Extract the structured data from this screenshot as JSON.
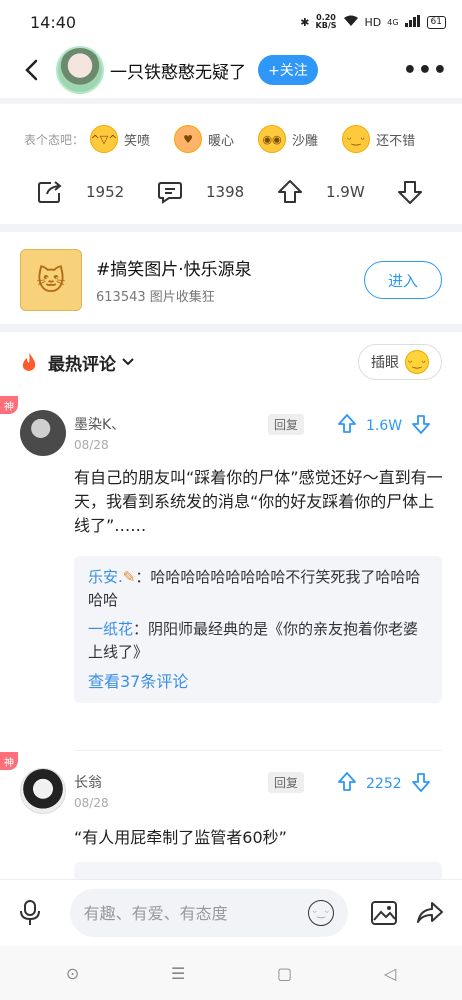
{
  "status": {
    "time": "14:40",
    "speed_value": "0.20",
    "speed_unit": "KB/S",
    "hd": "HD",
    "signal": "4G",
    "battery": "61"
  },
  "nav": {
    "name": "一只铁憨憨无疑了",
    "follow_label": "+关注"
  },
  "reactions": {
    "label": "表个态吧：",
    "items": [
      {
        "label": "笑喷",
        "icon": "laugh-cry-emoji"
      },
      {
        "label": "暖心",
        "icon": "heart-hug-emoji"
      },
      {
        "label": "沙雕",
        "icon": "silly-emoji"
      },
      {
        "label": "还不错",
        "icon": "okay-emoji"
      }
    ]
  },
  "stats": {
    "shares": "1952",
    "comments": "1398",
    "likes": "1.9W"
  },
  "topic": {
    "title": "#搞笑图片·快乐源泉",
    "subtitle": "613543 图片收集狂",
    "enter_label": "进入"
  },
  "hot": {
    "title": "最热评论",
    "insert_label": "插眼"
  },
  "comments": [
    {
      "badge": "神",
      "name": "墨染K、",
      "date": "08/28",
      "reply_label": "回复",
      "likes": "1.6W",
      "body": "有自己的朋友叫“踩着你的尸体”感觉还好～直到有一天，我看到系统发的消息“你的好友踩着你的尸体上线了”……",
      "replies": [
        {
          "user": "乐安.",
          "text": "：哈哈哈哈哈哈哈哈哈不行笑死我了哈哈哈哈哈"
        },
        {
          "user": "一纸花",
          "text": "：阴阳师最经典的是《你的亲友抱着你老婆上线了》"
        }
      ],
      "see_more": "查看37条评论"
    },
    {
      "badge": "神",
      "name": "长翁",
      "date": "08/28",
      "reply_label": "回复",
      "likes": "2252",
      "body": "“有人用屁牵制了监管者60秒”"
    }
  ],
  "input": {
    "placeholder": "有趣、有爱、有态度"
  },
  "colors": {
    "accent": "#2e97f7",
    "badge": "#ff6f7a",
    "link": "#3a8ee6"
  }
}
